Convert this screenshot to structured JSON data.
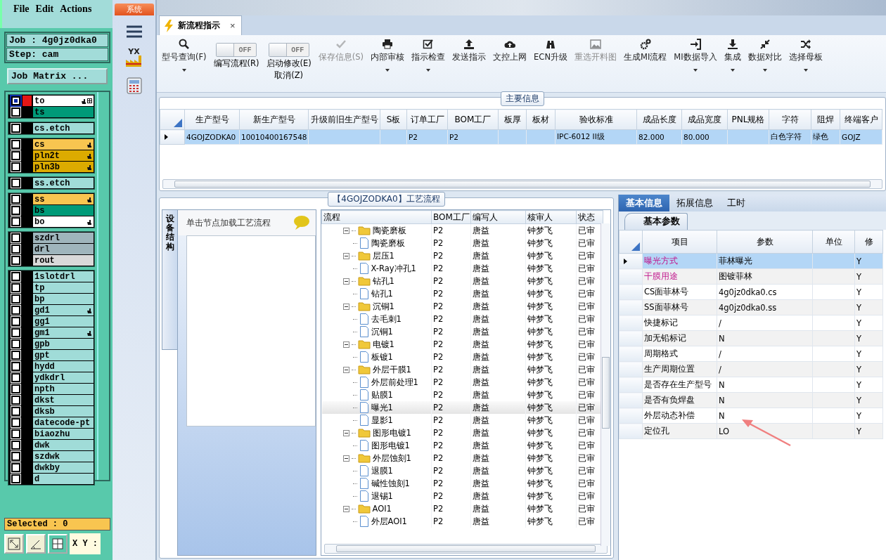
{
  "left_panel": {
    "menu": [
      "File",
      "Edit",
      "Actions"
    ],
    "job": "Job : 4g0jz0dka0",
    "step": "Step: cam",
    "matrix_button": "Job Matrix ...",
    "layer_groups": [
      {
        "layers": [
          {
            "name": "to",
            "color": "#ffffff",
            "active": true,
            "hand": true
          },
          {
            "name": "ts",
            "color": "#009a78",
            "active": false,
            "hand": false
          }
        ]
      },
      {
        "layers": [
          {
            "name": "cs.etch",
            "color": "#a0dcd8",
            "active": false,
            "hand": false
          }
        ]
      },
      {
        "layers": [
          {
            "name": "cs",
            "color": "#f8c550",
            "active": false,
            "hand": true
          },
          {
            "name": "pln2t",
            "color": "#dcab00",
            "active": false,
            "hand": true
          },
          {
            "name": "pln3b",
            "color": "#dcab00",
            "active": false,
            "hand": true
          }
        ]
      },
      {
        "layers": [
          {
            "name": "ss.etch",
            "color": "#a0dcd8",
            "active": false,
            "hand": false
          }
        ]
      },
      {
        "layers": [
          {
            "name": "ss",
            "color": "#f8c550",
            "active": false,
            "hand": true
          },
          {
            "name": "bs",
            "color": "#009a78",
            "active": false,
            "hand": false
          },
          {
            "name": "bo",
            "color": "#ffffff",
            "active": false,
            "hand": true
          }
        ]
      },
      {
        "layers": [
          {
            "name": "szdrl",
            "color": "#9fb5bc",
            "active": false,
            "hand": false
          },
          {
            "name": "drl",
            "color": "#9fb5bc",
            "active": false,
            "hand": false
          },
          {
            "name": "rout",
            "color": "#d9d9d9",
            "active": false,
            "hand": false
          }
        ]
      },
      {
        "layers": [
          {
            "name": "1slotdrl",
            "color": "#a0dcd8",
            "active": false,
            "hand": false
          },
          {
            "name": "tp",
            "color": "#a0dcd8",
            "active": false,
            "hand": false
          },
          {
            "name": "bp",
            "color": "#a0dcd8",
            "active": false,
            "hand": false
          },
          {
            "name": "gd1",
            "color": "#a0dcd8",
            "active": false,
            "hand": true
          },
          {
            "name": "gg1",
            "color": "#a0dcd8",
            "active": false,
            "hand": false
          },
          {
            "name": "gm1",
            "color": "#a0dcd8",
            "active": false,
            "hand": true
          },
          {
            "name": "gpb",
            "color": "#a0dcd8",
            "active": false,
            "hand": false
          },
          {
            "name": "gpt",
            "color": "#a0dcd8",
            "active": false,
            "hand": false
          },
          {
            "name": "hydd",
            "color": "#a0dcd8",
            "active": false,
            "hand": false
          },
          {
            "name": "ydkdrl",
            "color": "#a0dcd8",
            "active": false,
            "hand": false
          },
          {
            "name": "npth",
            "color": "#a0dcd8",
            "active": false,
            "hand": false
          },
          {
            "name": "dkst",
            "color": "#a0dcd8",
            "active": false,
            "hand": false
          },
          {
            "name": "dksb",
            "color": "#a0dcd8",
            "active": false,
            "hand": false
          },
          {
            "name": "datecode-pt",
            "color": "#a0dcd8",
            "active": false,
            "hand": false
          },
          {
            "name": "biaozhu",
            "color": "#a0dcd8",
            "active": false,
            "hand": false
          },
          {
            "name": "dwk",
            "color": "#a0dcd8",
            "active": false,
            "hand": false
          },
          {
            "name": "szdwk",
            "color": "#a0dcd8",
            "active": false,
            "hand": false
          },
          {
            "name": "dwkby",
            "color": "#a0dcd8",
            "active": false,
            "hand": false
          },
          {
            "name": "d",
            "color": "#a0dcd8",
            "active": false,
            "hand": false
          }
        ]
      }
    ],
    "selected_count": "Selected : 0",
    "coord_label": "X Y :"
  },
  "sidebar": {
    "system_tab": "系统",
    "logo": "YX"
  },
  "document_tab": {
    "title": "新流程指示",
    "close": "×"
  },
  "toolbar": [
    {
      "kind": "button",
      "label": "型号查询(F)",
      "dropdown": true,
      "disabled": false
    },
    {
      "kind": "toggle",
      "label": "编写流程(R)",
      "state": "OFF",
      "on": false
    },
    {
      "kind": "toggle",
      "label": "启动修改(E)",
      "sublabel": "取消(Z)",
      "state": "OFF",
      "on": false
    },
    {
      "kind": "button",
      "label": "保存信息(S)",
      "dropdown": false,
      "disabled": true
    },
    {
      "kind": "button",
      "label": "内部审核",
      "dropdown": true,
      "disabled": false
    },
    {
      "kind": "button",
      "label": "指示检查",
      "dropdown": true,
      "disabled": false
    },
    {
      "kind": "button",
      "label": "发送指示",
      "dropdown": false,
      "disabled": false
    },
    {
      "kind": "button",
      "label": "文控上网",
      "dropdown": false,
      "disabled": false
    },
    {
      "kind": "button",
      "label": "ECN升级",
      "dropdown": false,
      "disabled": false
    },
    {
      "kind": "button",
      "label": "重选开料图",
      "dropdown": false,
      "disabled": true
    },
    {
      "kind": "button",
      "label": "生成MI流程",
      "dropdown": false,
      "disabled": false
    },
    {
      "kind": "button",
      "label": "MI数据导入",
      "dropdown": true,
      "disabled": false
    },
    {
      "kind": "button",
      "label": "集成",
      "dropdown": true,
      "disabled": false
    },
    {
      "kind": "button",
      "label": "数据对比",
      "dropdown": true,
      "disabled": false
    },
    {
      "kind": "button",
      "label": "选择母板",
      "dropdown": true,
      "disabled": false
    }
  ],
  "main_info": {
    "legend": "主要信息",
    "columns": [
      "生产型号",
      "新生产型号",
      "升级前旧生产型号",
      "S板",
      "订单工厂",
      "BOM工厂",
      "板厚",
      "板材",
      "验收标准",
      "成品长度",
      "成品宽度",
      "PNL规格",
      "字符",
      "阻焊",
      "终端客户"
    ],
    "rows": [
      {
        "selected": true,
        "cells": [
          "4GOJZODKA0",
          "10010400167548",
          null,
          null,
          "P2",
          "P2",
          null,
          null,
          "IPC-6012 II级",
          "82.000",
          "80.000",
          null,
          "白色字符",
          "绿色",
          "GOJZ"
        ]
      }
    ]
  },
  "process": {
    "legend": "【4GOJZODKA0】工艺流程",
    "side_tab": "设备结构",
    "hint": "单击节点加载工艺流程",
    "columns": [
      "流程",
      "BOM工厂",
      "编写人",
      "核审人",
      "状态"
    ],
    "nodes": [
      {
        "name": "陶瓷磨板",
        "bom": "P2",
        "writer": "唐益",
        "reviewer": "钟梦飞",
        "status": "已审",
        "expanded": true,
        "selected": false,
        "children": [
          {
            "name": "陶瓷磨板",
            "bom": "P2",
            "writer": "唐益",
            "reviewer": "钟梦飞",
            "status": "已审",
            "selected": false
          }
        ]
      },
      {
        "name": "层压1",
        "bom": "P2",
        "writer": "唐益",
        "reviewer": "钟梦飞",
        "status": "已审",
        "expanded": true,
        "selected": false,
        "children": [
          {
            "name": "X-Ray冲孔1",
            "bom": "P2",
            "writer": "唐益",
            "reviewer": "钟梦飞",
            "status": "已审",
            "selected": false
          }
        ]
      },
      {
        "name": "钻孔1",
        "bom": "P2",
        "writer": "唐益",
        "reviewer": "钟梦飞",
        "status": "已审",
        "expanded": true,
        "selected": false,
        "children": [
          {
            "name": "钻孔1",
            "bom": "P2",
            "writer": "唐益",
            "reviewer": "钟梦飞",
            "status": "已审",
            "selected": false
          }
        ]
      },
      {
        "name": "沉铜1",
        "bom": "P2",
        "writer": "唐益",
        "reviewer": "钟梦飞",
        "status": "已审",
        "expanded": true,
        "selected": false,
        "children": [
          {
            "name": "去毛刺1",
            "bom": "P2",
            "writer": "唐益",
            "reviewer": "钟梦飞",
            "status": "已审",
            "selected": false
          },
          {
            "name": "沉铜1",
            "bom": "P2",
            "writer": "唐益",
            "reviewer": "钟梦飞",
            "status": "已审",
            "selected": false
          }
        ]
      },
      {
        "name": "电镀1",
        "bom": "P2",
        "writer": "唐益",
        "reviewer": "钟梦飞",
        "status": "已审",
        "expanded": true,
        "selected": false,
        "children": [
          {
            "name": "板镀1",
            "bom": "P2",
            "writer": "唐益",
            "reviewer": "钟梦飞",
            "status": "已审",
            "selected": false
          }
        ]
      },
      {
        "name": "外层干膜1",
        "bom": "P2",
        "writer": "唐益",
        "reviewer": "钟梦飞",
        "status": "已审",
        "expanded": true,
        "selected": false,
        "children": [
          {
            "name": "外层前处理1",
            "bom": "P2",
            "writer": "唐益",
            "reviewer": "钟梦飞",
            "status": "已审",
            "selected": false
          },
          {
            "name": "贴膜1",
            "bom": "P2",
            "writer": "唐益",
            "reviewer": "钟梦飞",
            "status": "已审",
            "selected": false
          },
          {
            "name": "曝光1",
            "bom": "P2",
            "writer": "唐益",
            "reviewer": "钟梦飞",
            "status": "已审",
            "selected": true
          },
          {
            "name": "显影1",
            "bom": "P2",
            "writer": "唐益",
            "reviewer": "钟梦飞",
            "status": "已审",
            "selected": false
          }
        ]
      },
      {
        "name": "图形电镀1",
        "bom": "P2",
        "writer": "唐益",
        "reviewer": "钟梦飞",
        "status": "已审",
        "expanded": true,
        "selected": false,
        "children": [
          {
            "name": "图形电镀1",
            "bom": "P2",
            "writer": "唐益",
            "reviewer": "钟梦飞",
            "status": "已审",
            "selected": false
          }
        ]
      },
      {
        "name": "外层蚀刻1",
        "bom": "P2",
        "writer": "唐益",
        "reviewer": "钟梦飞",
        "status": "已审",
        "expanded": true,
        "selected": false,
        "children": [
          {
            "name": "退膜1",
            "bom": "P2",
            "writer": "唐益",
            "reviewer": "钟梦飞",
            "status": "已审",
            "selected": false
          },
          {
            "name": "碱性蚀刻1",
            "bom": "P2",
            "writer": "唐益",
            "reviewer": "钟梦飞",
            "status": "已审",
            "selected": false
          },
          {
            "name": "退锡1",
            "bom": "P2",
            "writer": "唐益",
            "reviewer": "钟梦飞",
            "status": "已审",
            "selected": false
          }
        ]
      },
      {
        "name": "AOI1",
        "bom": "P2",
        "writer": "唐益",
        "reviewer": "钟梦飞",
        "status": "已审",
        "expanded": true,
        "selected": false,
        "children": [
          {
            "name": "外层AOI1",
            "bom": "P2",
            "writer": "唐益",
            "reviewer": "钟梦飞",
            "status": "已审",
            "selected": false
          }
        ]
      }
    ]
  },
  "detail": {
    "tabs": [
      {
        "label": "基本信息",
        "selected": true
      },
      {
        "label": "拓展信息",
        "selected": false
      },
      {
        "label": "工时",
        "selected": false
      }
    ],
    "subtab": "基本参数",
    "columns": [
      "项目",
      "参数",
      "单位",
      "修"
    ],
    "rows": [
      {
        "item": "曝光方式",
        "value": "菲林曝光",
        "modified": "Y",
        "highlight": true,
        "selected": true
      },
      {
        "item": "干膜用途",
        "value": "图镀菲林",
        "modified": "Y",
        "highlight": true,
        "selected": false
      },
      {
        "item": "CS面菲林号",
        "value": "4g0jz0dka0.cs",
        "modified": "Y",
        "highlight": false,
        "selected": false
      },
      {
        "item": "SS面菲林号",
        "value": "4g0jz0dka0.ss",
        "modified": "Y",
        "highlight": false,
        "selected": false
      },
      {
        "item": "快捷标记",
        "value": "/",
        "modified": "Y",
        "highlight": false,
        "selected": false
      },
      {
        "item": "加无铅标记",
        "value": "N",
        "modified": "Y",
        "highlight": false,
        "selected": false
      },
      {
        "item": "周期格式",
        "value": "/",
        "modified": "Y",
        "highlight": false,
        "selected": false
      },
      {
        "item": "生产周期位置",
        "value": "/",
        "modified": "Y",
        "highlight": false,
        "selected": false
      },
      {
        "item": "是否存在生产型号",
        "value": "N",
        "modified": "Y",
        "highlight": false,
        "selected": false
      },
      {
        "item": "是否有负焊盘",
        "value": "N",
        "modified": "Y",
        "highlight": false,
        "selected": false
      },
      {
        "item": "外层动态补偿",
        "value": "N",
        "modified": "Y",
        "highlight": false,
        "selected": false
      },
      {
        "item": "定位孔",
        "value": "LO",
        "modified": "Y",
        "highlight": false,
        "selected": false
      }
    ],
    "annotation": {
      "kind": "arrow"
    }
  }
}
